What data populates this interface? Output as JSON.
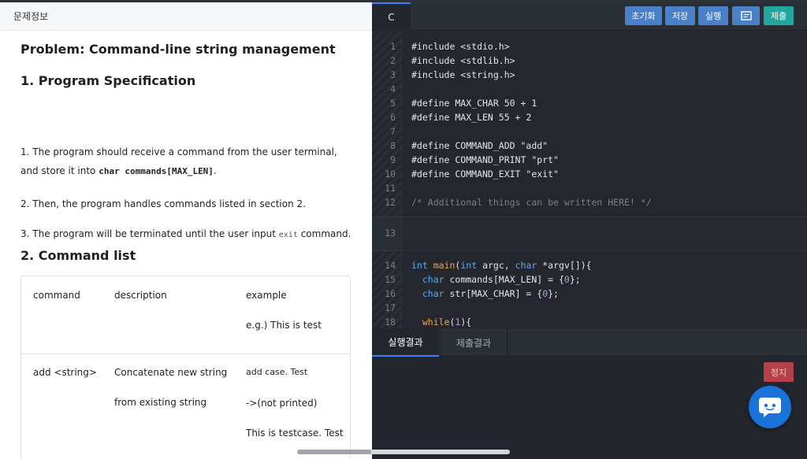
{
  "left_panel": {
    "header_title": "문제정보",
    "problem_title": "Problem: Command-line string management",
    "section1_title": "1. Program Specification",
    "spec1_text_a": "1. The program should receive a command from the user terminal, and store it into",
    "spec1_code": "char commands[MAX_LEN]",
    "spec1_text_b": ".",
    "spec2_text": "2. Then, the program handles commands listed in section 2.",
    "spec3_text_a": "3. The program will be terminated until the user input",
    "spec3_code": "exit",
    "spec3_text_b": "command.",
    "section2_title": "2. Command list",
    "table": {
      "headers": [
        "command",
        "description",
        "example"
      ],
      "header_example_extra": "e.g.) This is test",
      "rows": [
        {
          "command": "add <string>",
          "description_line1": "Concatenate new string",
          "description_line2": "from existing string",
          "example_line1": "add case. Test",
          "example_line2": "->(not printed)",
          "example_line3": "This is testcase. Test"
        }
      ]
    }
  },
  "editor": {
    "language_tab": "C",
    "buttons": {
      "reset": "초기화",
      "save": "저장",
      "run": "실행",
      "submit": "제출"
    },
    "line_numbers": [
      "1",
      "2",
      "3",
      "4",
      "5",
      "6",
      "7",
      "8",
      "9",
      "10",
      "11",
      "12",
      "13",
      "14",
      "15",
      "16",
      "17",
      "18"
    ],
    "code": {
      "l1": "#include <stdio.h>",
      "l2": "#include <stdlib.h>",
      "l3": "#include <string.h>",
      "l5": "#define MAX_CHAR 50 + 1",
      "l6": "#define MAX_LEN 55 + 2",
      "l8": "#define COMMAND_ADD \"add\"",
      "l9": "#define COMMAND_PRINT \"prt\"",
      "l10": "#define COMMAND_EXIT \"exit\"",
      "l12": "/* Additional things can be written HERE! */",
      "l14_kw": "int",
      "l14_fn": "main",
      "l14_a": "(",
      "l14_kw2": "int",
      "l14_b": " argc, ",
      "l14_kw3": "char",
      "l14_c": " *argv[]){",
      "l15_kw": "char",
      "l15_a": " commands[MAX_LEN] = {",
      "l15_num": "0",
      "l15_b": "};",
      "l16_kw": "char",
      "l16_a": " str[MAX_CHAR] = {",
      "l16_num": "0",
      "l16_b": "};",
      "l18_kw": "while",
      "l18_a": "(",
      "l18_num": "1",
      "l18_b": "){"
    }
  },
  "result_panel": {
    "tab_run_result": "실행결과",
    "tab_submit_result": "제출결과",
    "stop_button": "정지"
  },
  "icons": {
    "memo": "memo-icon",
    "chat": "chat-bubble-icon"
  },
  "colors": {
    "accent_blue": "#4a80c8",
    "submit_teal": "#22a6a0",
    "stop_red": "#b5424a",
    "chat_blue": "#1a73d9"
  }
}
